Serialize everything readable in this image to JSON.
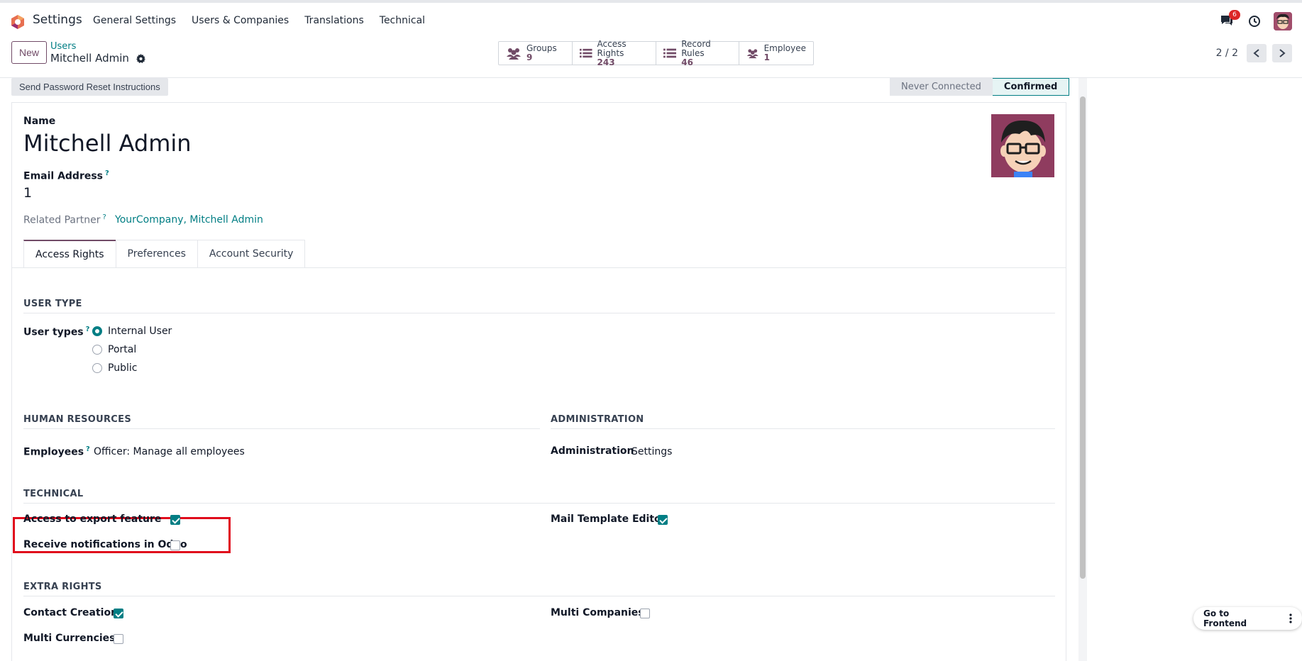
{
  "navbar": {
    "app_title": "Settings",
    "menu": [
      "General Settings",
      "Users & Companies",
      "Translations",
      "Technical"
    ],
    "chat_count": "6"
  },
  "control": {
    "new_label": "New",
    "breadcrumb_parent": "Users",
    "breadcrumb_current": "Mitchell Admin",
    "smart_buttons": [
      {
        "label": "Groups",
        "value": "9",
        "icon": "users-icon"
      },
      {
        "label": "Access Rights",
        "value": "243",
        "icon": "list-icon"
      },
      {
        "label": "Record Rules",
        "value": "46",
        "icon": "list-icon"
      },
      {
        "label": "Employee",
        "value": "1",
        "icon": "users-icon"
      }
    ],
    "pager": "2 / 2"
  },
  "form": {
    "reset_button": "Send Password Reset Instructions",
    "status": [
      "Never Connected",
      "Confirmed"
    ],
    "name_label": "Name",
    "name_value": "Mitchell Admin",
    "email_label": "Email Address",
    "email_value": "1",
    "partner_label": "Related Partner",
    "partner_value": "YourCompany, Mitchell Admin",
    "tabs": [
      "Access Rights",
      "Preferences",
      "Account Security"
    ],
    "user_type_section": "USER TYPE",
    "user_types_label": "User types",
    "user_types": [
      "Internal User",
      "Portal",
      "Public"
    ],
    "hr_section": "HUMAN RESOURCES",
    "employees_label": "Employees",
    "employees_value": "Officer: Manage all employees",
    "admin_section": "ADMINISTRATION",
    "admin_label": "Administration",
    "admin_value": "Settings",
    "technical_section": "TECHNICAL",
    "export_label": "Access to export feature",
    "notif_label": "Receive notifications in Odoo",
    "mail_template_label": "Mail Template Editor",
    "extra_section": "EXTRA RIGHTS",
    "contact_creation_label": "Contact Creation",
    "multi_companies_label": "Multi Companies",
    "multi_currencies_label": "Multi Currencies"
  },
  "footer": {
    "go_frontend": "Go to Frontend"
  },
  "colors": {
    "brand": "#714b67",
    "accent": "#017e84",
    "highlight": "#e00b1c"
  }
}
